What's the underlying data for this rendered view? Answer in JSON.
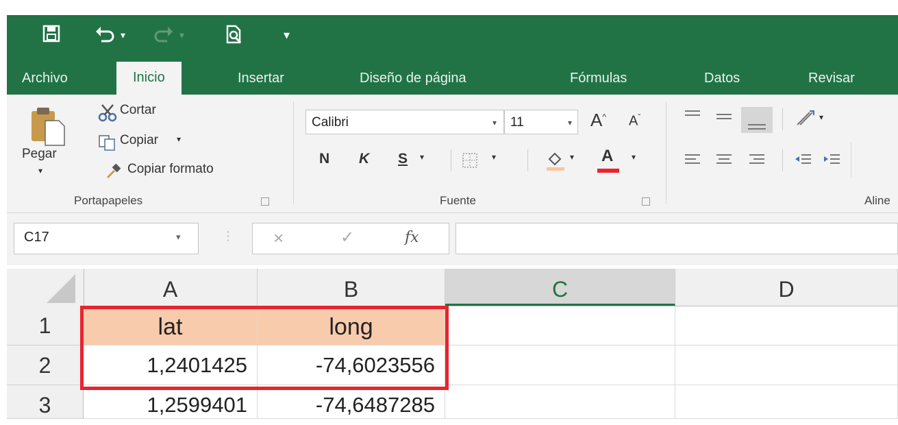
{
  "quick_access": {
    "save_icon": "save-icon",
    "undo_icon": "undo-icon",
    "redo_icon": "redo-icon",
    "print_preview_icon": "print-preview-icon",
    "customize_icon": "customize-qat-icon"
  },
  "tabs": [
    {
      "label": "Archivo",
      "active": false
    },
    {
      "label": "Inicio",
      "active": true
    },
    {
      "label": "Insertar",
      "active": false
    },
    {
      "label": "Diseño de página",
      "active": false
    },
    {
      "label": "Fórmulas",
      "active": false
    },
    {
      "label": "Datos",
      "active": false
    },
    {
      "label": "Revisar",
      "active": false
    }
  ],
  "ribbon": {
    "clipboard": {
      "paste_label": "Pegar",
      "cut_label": "Cortar",
      "copy_label": "Copiar",
      "format_painter_label": "Copiar formato",
      "group_label": "Portapapeles"
    },
    "font": {
      "font_name": "Calibri",
      "font_size": "11",
      "bold_label": "N",
      "italic_label": "K",
      "underline_label": "S",
      "font_color_label": "A",
      "font_color": "#e8242e",
      "group_label": "Fuente"
    },
    "alignment": {
      "group_label": "Aline"
    }
  },
  "formula_bar": {
    "name_box": "C17",
    "cancel_symbol": "×",
    "enter_symbol": "✓",
    "fx_symbol": "fx",
    "formula": ""
  },
  "sheet": {
    "columns": [
      "A",
      "B",
      "C",
      "D"
    ],
    "selected_column": "C",
    "rows": [
      {
        "row": "1",
        "cells": [
          "lat",
          "long",
          "",
          ""
        ]
      },
      {
        "row": "2",
        "cells": [
          "1,2401425",
          "-74,6023556",
          "",
          ""
        ]
      },
      {
        "row": "3",
        "cells": [
          "1,2599401",
          "-74,6487285",
          "",
          ""
        ]
      }
    ],
    "header_fill": "#f8cbad",
    "highlight_color": "#e8242e"
  },
  "colors": {
    "accent": "#217346"
  }
}
